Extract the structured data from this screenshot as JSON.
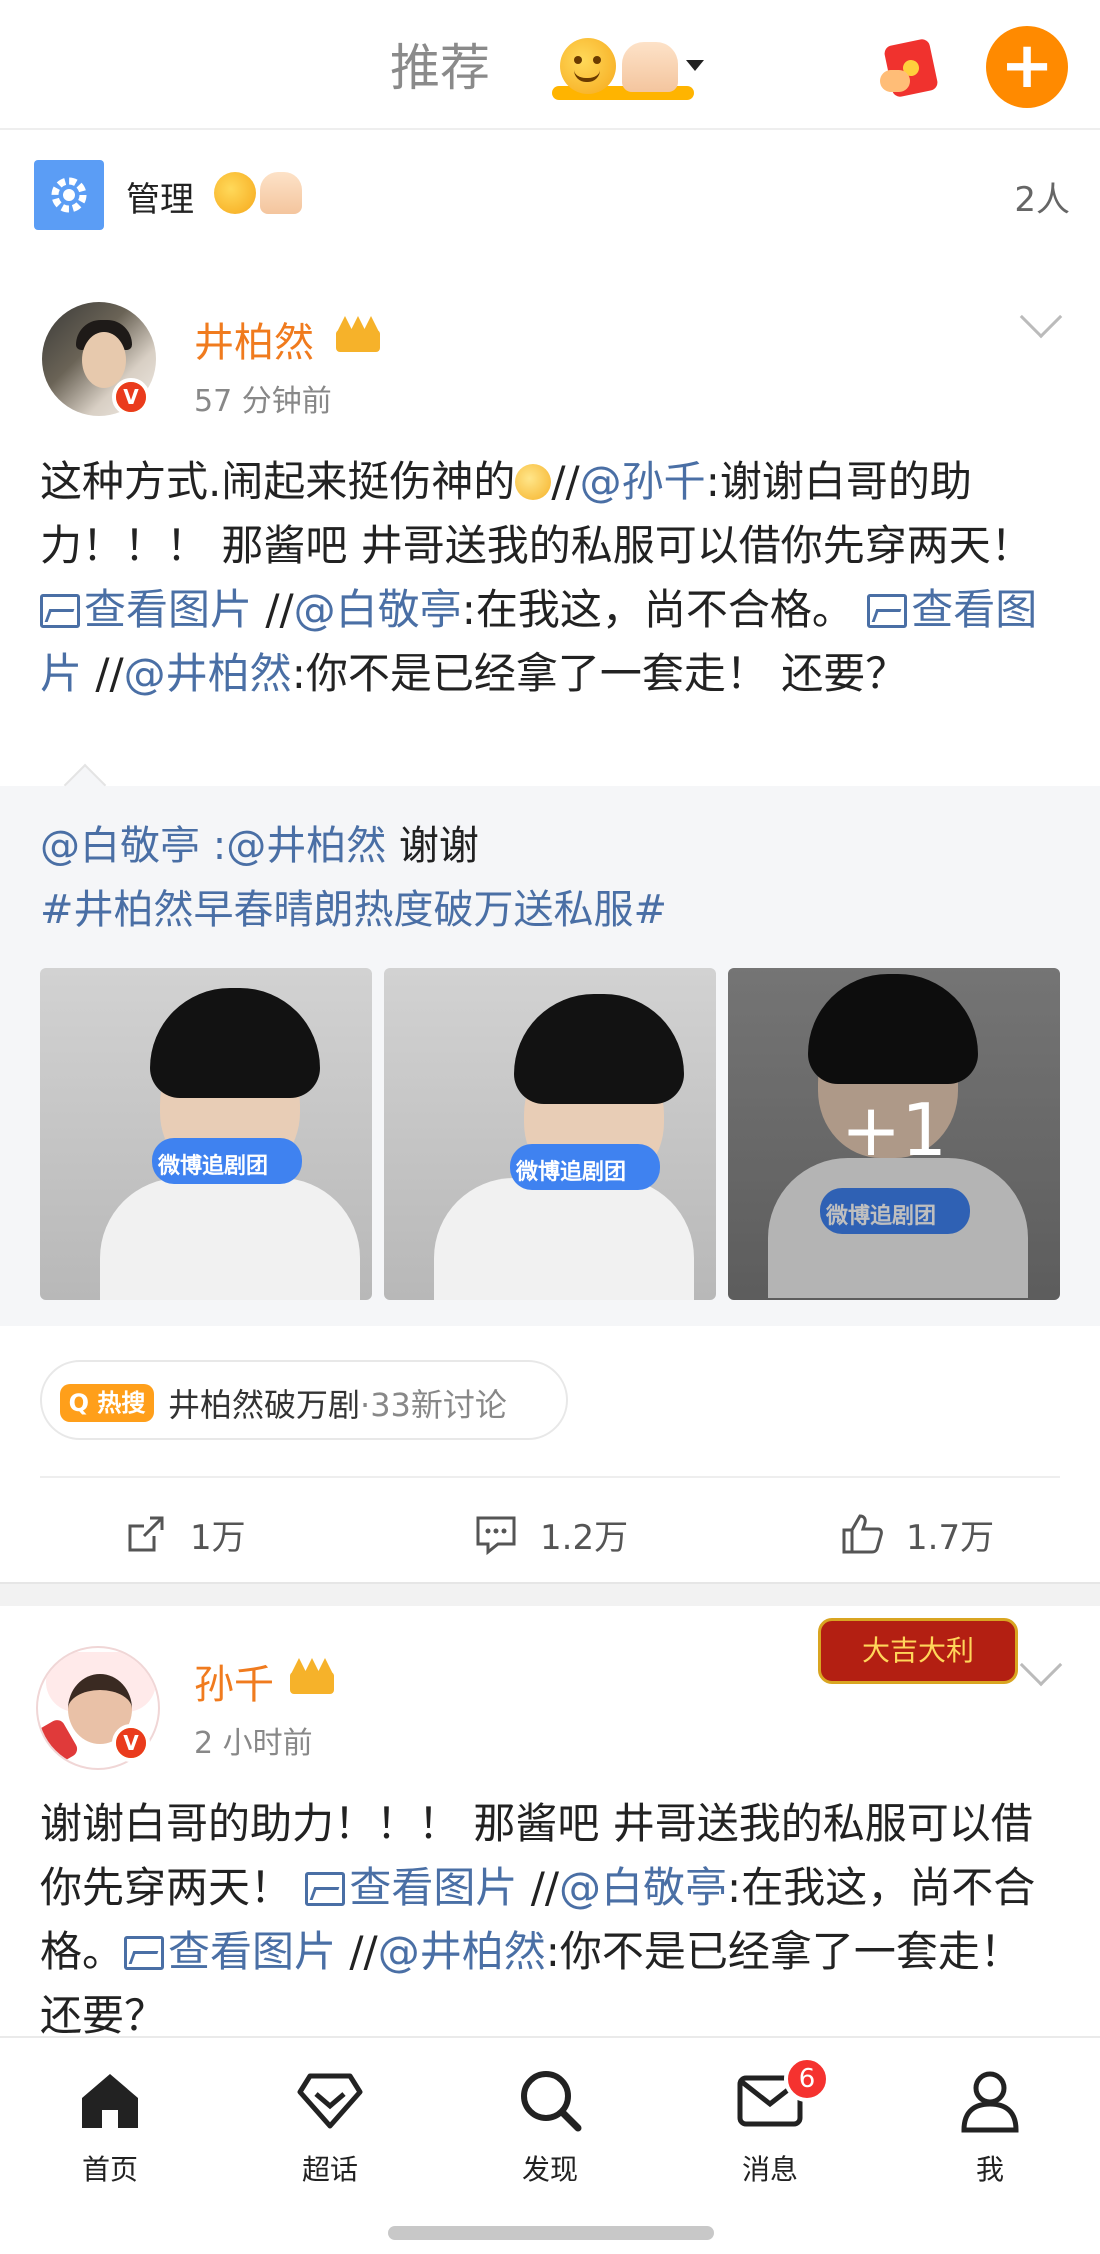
{
  "header": {
    "tab_recommend": "推荐",
    "group_tab_emoji": [
      "smiling-face-icon",
      "raised-hands-icon"
    ],
    "accent_color": "#ff8a00"
  },
  "manage_bar": {
    "label": "管理",
    "count": "2人"
  },
  "post1": {
    "author": "井柏然",
    "time": "57 分钟前",
    "text": {
      "p1": "这种方式.闹起来挺伤神的",
      "sep1": "//",
      "m1": "@孙千",
      "p2": ":谢谢白哥的助力！！！ 那酱吧 井哥送我的私服可以借你先穿两天！ ",
      "img1": "查看图片",
      "sep2": " //",
      "m2": "@白敬亭",
      "p3": ":在我这，尚不合格。 ",
      "img2": "查看图片",
      "sep3": " //",
      "m3": "@井柏然",
      "p4": ":你不是已经拿了一套走！ 还要？"
    },
    "repost": {
      "m1": "@白敬亭",
      "sep": " :",
      "m2": "@井柏然",
      "p1": " 谢谢",
      "topic": "#井柏然早春晴朗热度破万送私服#",
      "images": [
        {
          "mic_label": "微博追剧团"
        },
        {
          "mic_label": "微博追剧团"
        },
        {
          "mic_label": "微博追剧团",
          "more": "+1"
        }
      ]
    },
    "hot_search": {
      "badge": "热搜",
      "topic": "井柏然破万剧",
      "sub": "·33新讨论"
    },
    "actions": {
      "repost_count": "1万",
      "comment_count": "1.2万",
      "like_count": "1.7万"
    }
  },
  "post2": {
    "author": "孙千",
    "time": "2 小时前",
    "decoration": "大吉大利",
    "text": {
      "p1": "谢谢白哥的助力！！！ 那酱吧 井哥送我的私服可以借你先穿两天！ ",
      "img1": "查看图片",
      "sep1": " //",
      "m1": "@白敬亭",
      "p2": ":在我这，尚不合格。",
      "img2": "查看图片",
      "sep2": " //",
      "m2": "@井柏然",
      "p3": ":你不是已经拿了一套走！ 还要？"
    }
  },
  "bottom_nav": {
    "items": [
      {
        "label": "首页",
        "icon": "home-icon"
      },
      {
        "label": "超话",
        "icon": "diamond-icon"
      },
      {
        "label": "发现",
        "icon": "search-icon"
      },
      {
        "label": "消息",
        "icon": "mail-icon",
        "badge": "6"
      },
      {
        "label": "我",
        "icon": "person-icon"
      }
    ]
  }
}
